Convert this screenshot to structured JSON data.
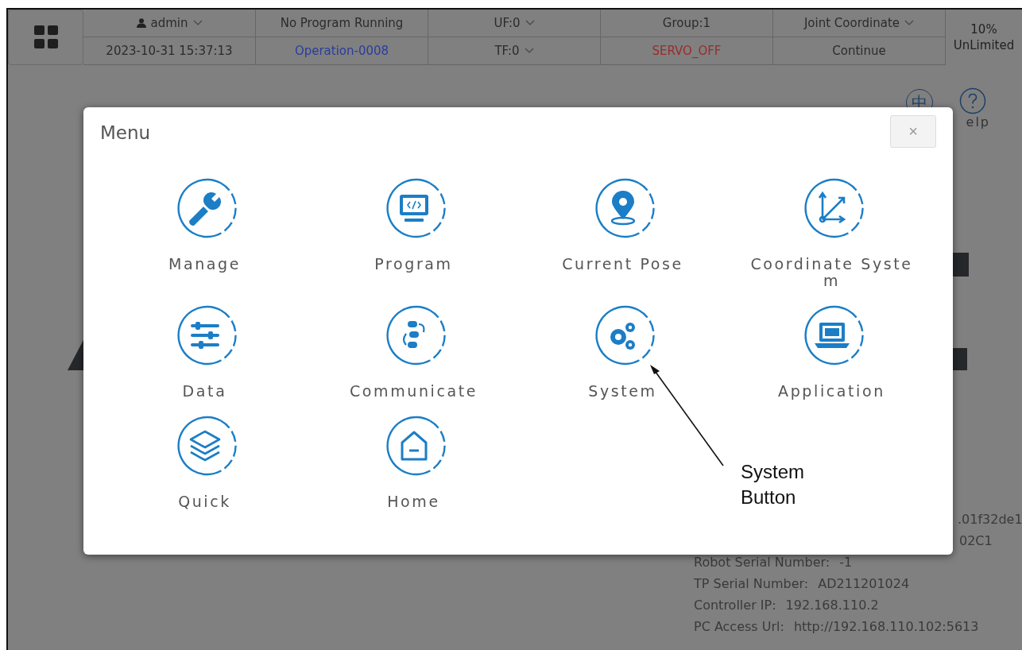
{
  "header": {
    "columns": [
      {
        "top": {
          "user_icon": true,
          "text": "admin",
          "dropdown": true,
          "color": "#2b2b2b"
        },
        "bottom": {
          "user_icon": false,
          "text": "2023-10-31 15:37:13",
          "dropdown": false,
          "color": "#2b2b2b"
        }
      },
      {
        "top": {
          "user_icon": false,
          "text": "No Program Running",
          "dropdown": false,
          "color": "#2b2b2b"
        },
        "bottom": {
          "user_icon": false,
          "text": "Operation-0008",
          "dropdown": false,
          "color": "#2a3c9c"
        }
      },
      {
        "top": {
          "user_icon": false,
          "text": "UF:0",
          "dropdown": true,
          "color": "#2b2b2b"
        },
        "bottom": {
          "user_icon": false,
          "text": "TF:0",
          "dropdown": true,
          "color": "#2b2b2b"
        }
      },
      {
        "top": {
          "user_icon": false,
          "text": "Group:1",
          "dropdown": false,
          "color": "#2b2b2b"
        },
        "bottom": {
          "user_icon": false,
          "text": "SERVO_OFF",
          "dropdown": false,
          "color": "#9c2a2a"
        }
      },
      {
        "top": {
          "user_icon": false,
          "text": "Joint Coordinate",
          "dropdown": true,
          "color": "#2b2b2b"
        },
        "bottom": {
          "user_icon": false,
          "text": "Continue",
          "dropdown": false,
          "color": "#2b2b2b"
        }
      }
    ],
    "speed": {
      "percent": "10%",
      "mode": "UnLimited"
    }
  },
  "background": {
    "language_icon": "中",
    "help_label": "elp",
    "fragments": [
      ".01f32de1",
      "02C1"
    ],
    "info": [
      {
        "label": "Robot Serial Number:",
        "value": "-1"
      },
      {
        "label": "TP Serial Number:",
        "value": "AD211201024"
      },
      {
        "label": "Controller IP:",
        "value": "192.168.110.2"
      },
      {
        "label": "PC Access Url:",
        "value": "http://192.168.110.102:5613"
      }
    ]
  },
  "dialog": {
    "title": "Menu",
    "close": "×",
    "items": [
      {
        "label": "Manage"
      },
      {
        "label": "Program"
      },
      {
        "label": "Current Pose"
      },
      {
        "label": "Coordinate System"
      },
      {
        "label": "Data"
      },
      {
        "label": "Communicate"
      },
      {
        "label": "System"
      },
      {
        "label": "Application"
      },
      {
        "label": "Quick"
      },
      {
        "label": "Home"
      }
    ]
  },
  "callout": {
    "text": "System Button"
  }
}
